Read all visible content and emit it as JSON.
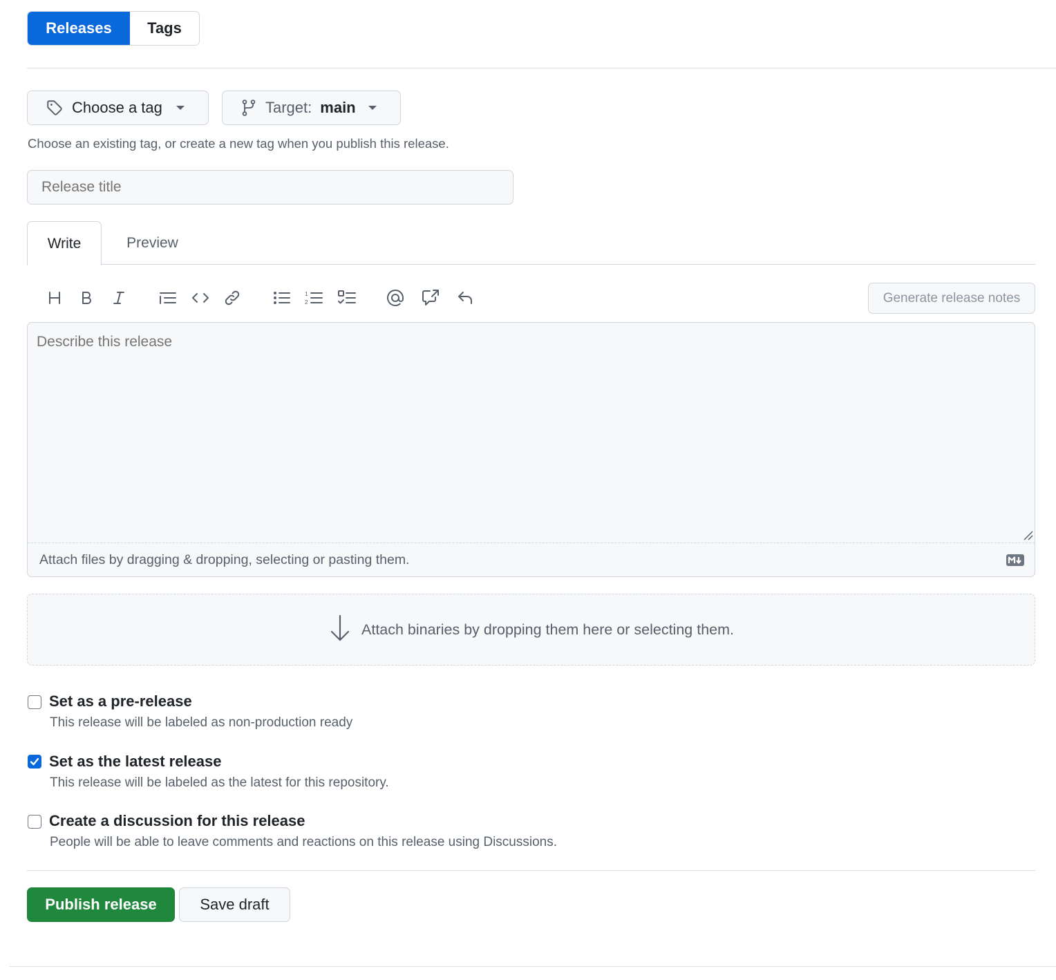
{
  "nav": {
    "tabs": [
      {
        "label": "Releases",
        "active": true
      },
      {
        "label": "Tags",
        "active": false
      }
    ]
  },
  "tag_picker": {
    "label": "Choose a tag",
    "icon": "tag-icon"
  },
  "target_picker": {
    "prefix": "Target:",
    "branch": "main",
    "icon": "git-branch-icon"
  },
  "tag_hint": "Choose an existing tag, or create a new tag when you publish this release.",
  "release_title": {
    "value": "",
    "placeholder": "Release title"
  },
  "editor": {
    "tabs": [
      {
        "label": "Write",
        "active": true
      },
      {
        "label": "Preview",
        "active": false
      }
    ],
    "toolbar": [
      {
        "name": "heading",
        "icon": "heading-icon"
      },
      {
        "name": "bold",
        "icon": "bold-icon"
      },
      {
        "name": "italic",
        "icon": "italic-icon"
      },
      {
        "name": "quote",
        "icon": "quote-icon"
      },
      {
        "name": "code",
        "icon": "code-icon"
      },
      {
        "name": "link",
        "icon": "link-icon"
      },
      {
        "name": "unordered-list",
        "icon": "list-unordered-icon"
      },
      {
        "name": "ordered-list",
        "icon": "list-ordered-icon"
      },
      {
        "name": "task-list",
        "icon": "tasklist-icon"
      },
      {
        "name": "mention",
        "icon": "mention-icon"
      },
      {
        "name": "reference",
        "icon": "cross-reference-icon"
      },
      {
        "name": "saved-replies",
        "icon": "reply-icon"
      }
    ],
    "generate_notes_label": "Generate release notes",
    "body": {
      "value": "",
      "placeholder": "Describe this release"
    },
    "attach_hint": "Attach files by dragging & dropping, selecting or pasting them.",
    "markdown_badge": "markdown-icon"
  },
  "binaries_dropzone": {
    "text": "Attach binaries by dropping them here or selecting them.",
    "icon": "arrow-down-icon"
  },
  "options": [
    {
      "title": "Set as a pre-release",
      "description": "This release will be labeled as non-production ready",
      "checked": false
    },
    {
      "title": "Set as the latest release",
      "description": "This release will be labeled as the latest for this repository.",
      "checked": true
    },
    {
      "title": "Create a discussion for this release",
      "description": "People will be able to leave comments and reactions on this release using Discussions.",
      "checked": false
    }
  ],
  "actions": {
    "publish_label": "Publish release",
    "draft_label": "Save draft"
  },
  "colors": {
    "primary_blue": "#0969da",
    "publish_green": "#1f883d",
    "muted_text": "#57606a",
    "border": "#d0d7de",
    "canvas_subtle": "#f6f8fa"
  }
}
